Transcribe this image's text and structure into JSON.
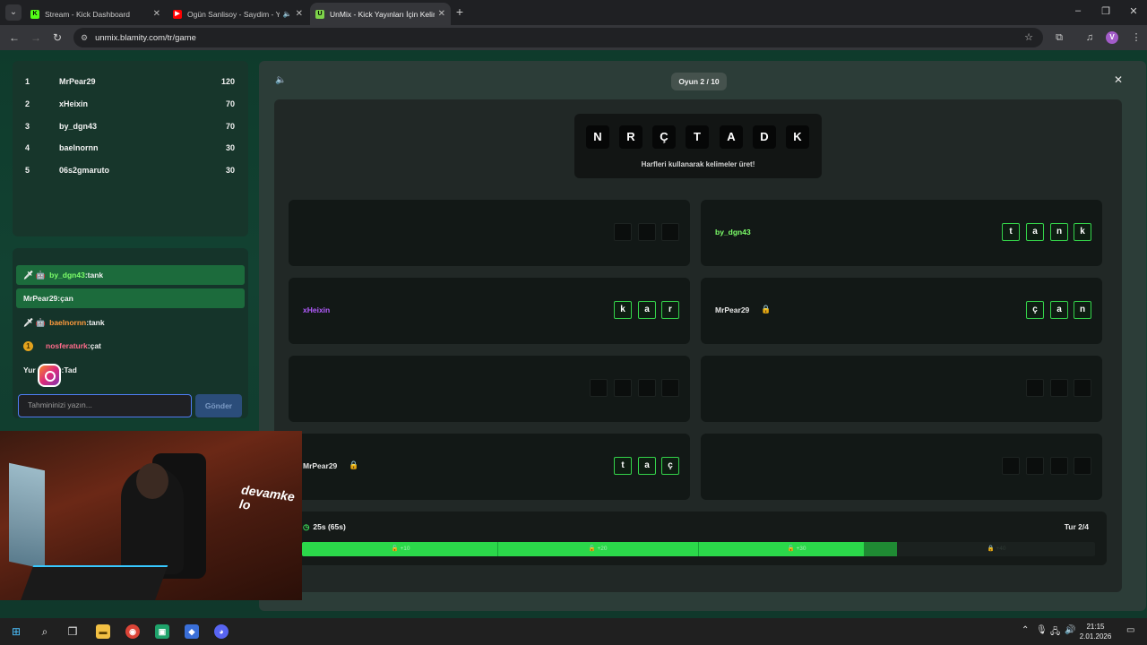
{
  "browser": {
    "tabs": [
      {
        "title": "Stream - Kick Dashboard",
        "favicon": "kick-icon",
        "favicon_color": "#53fc18",
        "active": false
      },
      {
        "title": "Ogün Sanlisoy - Saydim - Yo",
        "favicon": "youtube-icon",
        "favicon_color": "#ff0000",
        "active": false
      },
      {
        "title": "UnMix - Kick Yayınları İçin Kelim",
        "favicon": "unmix-icon",
        "favicon_color": "#7dd34a",
        "active": true
      }
    ],
    "url": "unmix.blamity.com/tr/game",
    "profile_initial": "V"
  },
  "leaderboard": [
    {
      "rank": "1",
      "name": "MrPear29",
      "score": "120"
    },
    {
      "rank": "2",
      "name": "xHeixin",
      "score": "70"
    },
    {
      "rank": "3",
      "name": "by_dgn43",
      "score": "70"
    },
    {
      "rank": "4",
      "name": "baelnornn",
      "score": "30"
    },
    {
      "rank": "5",
      "name": "06s2gmaruto",
      "score": "30"
    }
  ],
  "chat": {
    "messages": [
      {
        "user": "by_dgn43",
        "text": ":tank",
        "user_color": "green",
        "highlight": true,
        "badges": "🗡 🤖"
      },
      {
        "user": "MrPear29",
        "text": ":çan",
        "user_color": "white",
        "highlight": true,
        "badges": ""
      },
      {
        "user": "baelnornn",
        "text": ":tank",
        "user_color": "orange",
        "highlight": false,
        "badges": "🗡 🤖"
      },
      {
        "user": "nosferaturk",
        "text": ":çat",
        "user_color": "pink",
        "highlight": false,
        "badges": "1"
      },
      {
        "user": "Yur",
        "text": "):Tad",
        "user_color": "white",
        "highlight": false,
        "badges": ""
      }
    ],
    "input_placeholder": "Tahmininizi yazın...",
    "send_label": "Gönder"
  },
  "game": {
    "round_label": "Oyun 2 / 10",
    "letters": [
      "N",
      "R",
      "Ç",
      "T",
      "A",
      "D",
      "K"
    ],
    "hint": "Harfleri kullanarak kelimeler üret!",
    "slots": [
      {
        "user": "",
        "user_color": "",
        "locked": false,
        "tiles": [
          "",
          "",
          ""
        ],
        "filled": false
      },
      {
        "user": "by_dgn43",
        "user_color": "#7dff6a",
        "locked": false,
        "tiles": [
          "t",
          "a",
          "n",
          "k"
        ],
        "filled": true
      },
      {
        "user": "xHeixin",
        "user_color": "#b35cff",
        "locked": false,
        "tiles": [
          "k",
          "a",
          "r"
        ],
        "filled": true
      },
      {
        "user": "MrPear29",
        "user_color": "#e6e6e6",
        "locked": true,
        "tiles": [
          "ç",
          "a",
          "n"
        ],
        "filled": true
      },
      {
        "user": "",
        "user_color": "",
        "locked": false,
        "tiles": [
          "",
          "",
          "",
          ""
        ],
        "filled": false
      },
      {
        "user": "",
        "user_color": "",
        "locked": false,
        "tiles": [
          "",
          "",
          ""
        ],
        "filled": false
      },
      {
        "user": "MrPear29",
        "user_color": "#e6e6e6",
        "locked": true,
        "tiles": [
          "t",
          "a",
          "ç"
        ],
        "filled": true
      },
      {
        "user": "",
        "user_color": "",
        "locked": false,
        "tiles": [
          "",
          "",
          "",
          ""
        ],
        "filled": false
      }
    ],
    "timer": "25s (65s)",
    "round_count": "Tur 2/4",
    "progress": 0.708,
    "progress_next": 0.75,
    "progress_markers": [
      "+10",
      "+20",
      "+30",
      "+40"
    ]
  },
  "stream_overlay": {
    "text": "devamke lo"
  },
  "taskbar": {
    "time": "21:15",
    "date": "2.01.2026"
  },
  "colors": {
    "accent_green": "#2bd84a",
    "page_bg": "#10382b",
    "panel_bg": "#2c3d38"
  }
}
